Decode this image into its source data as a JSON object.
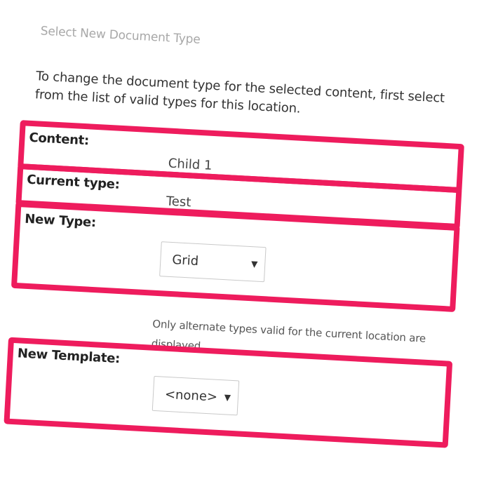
{
  "panel": {
    "title": "Select New Document Type",
    "intro": "To change the document type for the selected content, first select from the list of valid types for this location."
  },
  "fields": {
    "content": {
      "label": "Content:",
      "value": "Child 1"
    },
    "current_type": {
      "label": "Current type:",
      "value": "Test"
    },
    "new_type": {
      "label": "New Type:",
      "selected": "Grid",
      "hint": "Only alternate types valid for the current location are displayed."
    },
    "new_template": {
      "label": "New Template:",
      "selected": "<none>"
    }
  },
  "icons": {
    "dropdown": "caret-down-icon"
  },
  "colors": {
    "highlight": "#ee1c5d",
    "title": "#a8a8a8"
  }
}
